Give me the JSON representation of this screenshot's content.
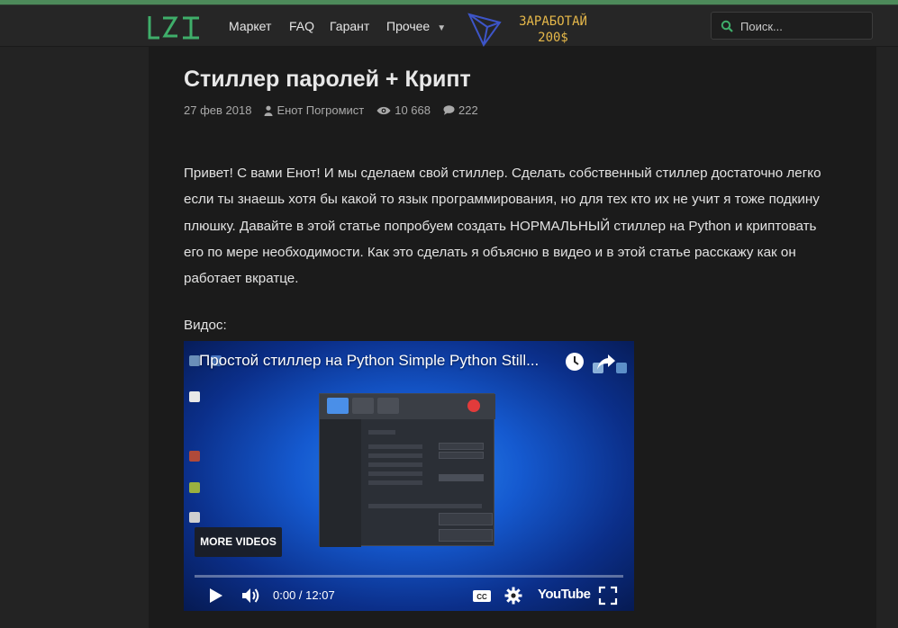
{
  "colors": {
    "accent": "#4d8a5a",
    "logo": "#3fae6a",
    "promo": "#e6b84a",
    "page_bg": "#232323",
    "content_bg": "#1b1b1b"
  },
  "nav": {
    "logo_icon": "site-logo",
    "items": [
      {
        "label": "Маркет"
      },
      {
        "label": "FAQ"
      },
      {
        "label": "Гарант"
      },
      {
        "label": "Прочее",
        "has_dropdown": true
      }
    ],
    "promo": {
      "line1": "ЗАРАБОТАЙ",
      "line2": "200$"
    },
    "search": {
      "placeholder": "Поиск..."
    }
  },
  "article": {
    "title": "Стиллер паролей + Крипт",
    "date": "27 фев 2018",
    "author": "Енот Погромист",
    "views": "10 668",
    "comments": "222",
    "body": "Привет! С вами Енот! И мы сделаем свой стиллер. Сделать собственный стиллер достаточно легко если ты знаешь хотя бы какой то язык программирования, но для тех кто их не учит я тоже подкину плюшку. Давайте в этой статье попробуем создать НОРМАЛЬНЫЙ стиллер на Python и криптовать его по мере необходимости. Как это сделать я объясню в видео и в этой статье расскажу как он работает вкратце.",
    "video_label": "Видос:"
  },
  "video": {
    "title": "Простой стиллер на Python Simple Python Still...",
    "more_videos": "MORE VIDEOS",
    "time": "0:00 / 12:07",
    "progress": 0.0,
    "brand": "YouTube"
  }
}
